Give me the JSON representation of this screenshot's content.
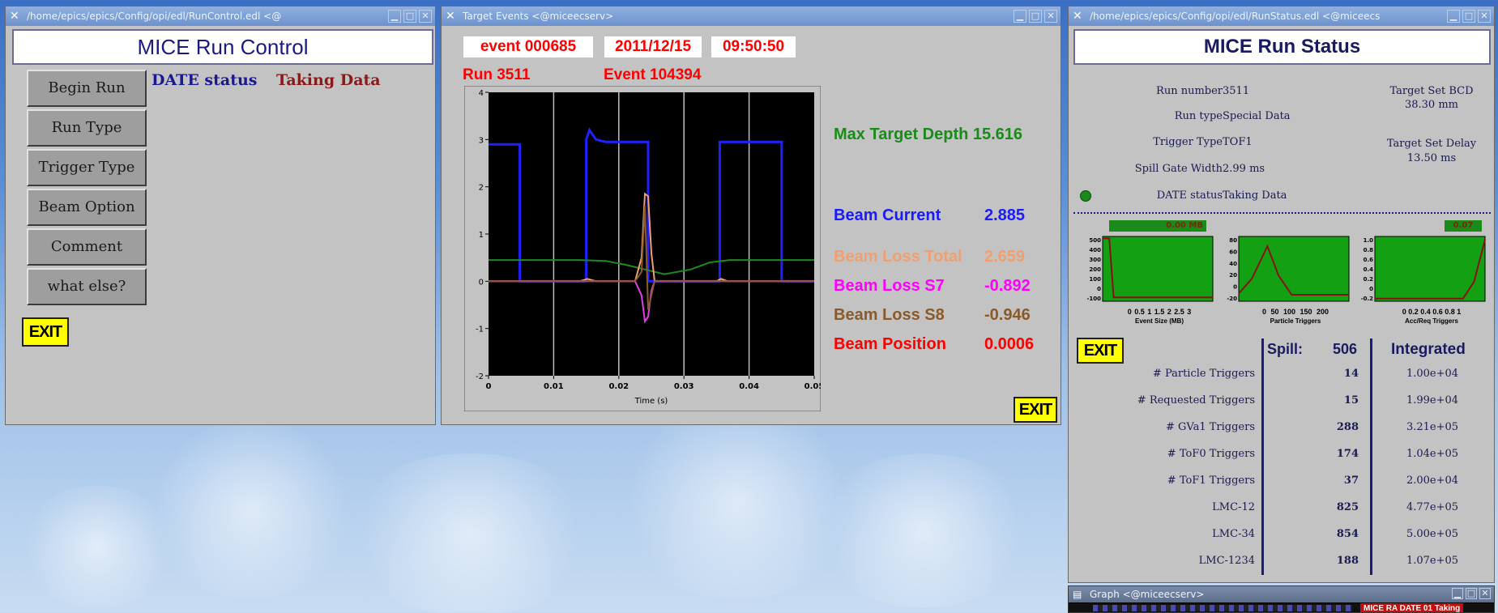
{
  "run_control": {
    "window_title": "/home/epics/epics/Config/opi/edl/RunControl.edl <@",
    "title": "MICE Run Control",
    "buttons": [
      "Begin Run",
      "Run Type",
      "Trigger Type",
      "Beam Option",
      "Comment",
      "what else?"
    ],
    "date_status_label": "DATE status",
    "date_status_value": "Taking Data",
    "exit_label": "EXIT"
  },
  "target_events": {
    "window_title": "Target Events <@miceecserv>",
    "event_label": "event 000685",
    "date": "2011/12/15",
    "time": "09:50:50",
    "run_label": "Run 3511",
    "event_count_label": "Event 104394",
    "max_depth_label": "Max Target Depth 15.616",
    "measurements": [
      {
        "label": "Beam Current",
        "value": "2.885",
        "color": "#1a1aff"
      },
      {
        "label": "Beam Loss Total",
        "value": "2.659",
        "color": "#f0a070"
      },
      {
        "label": "Beam Loss S7",
        "value": "-0.892",
        "color": "#ff00ff"
      },
      {
        "label": "Beam Loss S8",
        "value": "-0.946",
        "color": "#8a5a2a"
      },
      {
        "label": "Beam Position",
        "value": "0.0006",
        "color": "#ff0000"
      }
    ],
    "exit_label": "EXIT",
    "chart_data": {
      "type": "line",
      "xlabel": "Time (s)",
      "xlim": [
        0,
        0.05
      ],
      "ylim": [
        -2,
        4
      ],
      "x_ticks": [
        "0",
        "0.01",
        "0.02",
        "0.03",
        "0.04",
        "0.05"
      ],
      "y_ticks": [
        "-2",
        "-1",
        "0",
        "1",
        "2",
        "3",
        "4"
      ],
      "vlines": [
        0.01,
        0.02,
        0.03,
        0.04
      ],
      "series": [
        {
          "color": "#2020ff",
          "x": [
            0,
            0.0048,
            0.0048,
            0.015,
            0.015,
            0.0155,
            0.0165,
            0.018,
            0.0245,
            0.0245,
            0.0355,
            0.0355,
            0.0365,
            0.045,
            0.045,
            0.05
          ],
          "y": [
            2.9,
            2.9,
            0,
            0,
            3.0,
            3.2,
            3.0,
            2.95,
            2.95,
            0,
            0,
            2.95,
            2.95,
            2.95,
            0,
            0
          ]
        },
        {
          "color": "#1e8a1e",
          "x": [
            0,
            0.014,
            0.018,
            0.021,
            0.024,
            0.027,
            0.031,
            0.034,
            0.037,
            0.05
          ],
          "y": [
            0.45,
            0.45,
            0.43,
            0.35,
            0.25,
            0.15,
            0.25,
            0.4,
            0.45,
            0.45
          ]
        },
        {
          "color": "#f0a070",
          "x": [
            0,
            0.014,
            0.0152,
            0.0165,
            0.0225,
            0.0235,
            0.024,
            0.0245,
            0.025,
            0.0255,
            0.035,
            0.0357,
            0.0367,
            0.05
          ],
          "y": [
            0,
            0,
            0.05,
            0,
            0,
            0.5,
            1.85,
            1.8,
            0.6,
            0,
            0,
            0.05,
            0,
            0
          ]
        },
        {
          "color": "#e040e0",
          "x": [
            0,
            0.0225,
            0.0235,
            0.024,
            0.0245,
            0.025,
            0.0255,
            0.05
          ],
          "y": [
            0,
            0,
            -0.3,
            -0.85,
            -0.75,
            -0.2,
            0,
            0
          ]
        },
        {
          "color": "#8a5a2a",
          "x": [
            0,
            0.0225,
            0.0235,
            0.024,
            0.0245,
            0.025,
            0.0255,
            0.05
          ],
          "y": [
            0,
            0,
            0.2,
            1.6,
            -0.6,
            -0.3,
            0,
            0
          ]
        }
      ]
    }
  },
  "run_status": {
    "window_title": "/home/epics/epics/Config/opi/edl/RunStatus.edl <@miceecs",
    "title": "MICE Run Status",
    "fields": [
      {
        "label": "Run number",
        "value": "3511"
      },
      {
        "label": "Run type",
        "value": "Special Data"
      },
      {
        "label": "Trigger Type",
        "value": "TOF1"
      },
      {
        "label": "Spill Gate Width",
        "value": "2.99 ms"
      },
      {
        "label": "DATE status",
        "value": "Taking Data"
      }
    ],
    "target_bcd_label": "Target Set BCD",
    "target_bcd_value": "38.30 mm",
    "target_delay_label": "Target Set Delay",
    "target_delay_value": "13.50 ms",
    "mini_plots": [
      {
        "xlabel": "Event Size (MB)",
        "xticks": "0 0.5 1 1.5 2 2.5 3",
        "yticks": [
          "500",
          "400",
          "300",
          "200",
          "100",
          "0",
          "-100"
        ],
        "badge": "0.00 MB"
      },
      {
        "xlabel": "Particle Triggers",
        "xticks": "0 50 100 150 200",
        "yticks": [
          "80",
          "60",
          "40",
          "20",
          "0",
          "-20"
        ],
        "badge": ""
      },
      {
        "xlabel": "Acc/Req Triggers",
        "xticks": "0 0.2 0.4 0.6 0.8 1",
        "yticks": [
          "1.0",
          "0.8",
          "0.6",
          "0.4",
          "0.2",
          "0",
          "-0.2"
        ],
        "badge": "0.07"
      }
    ],
    "exit_label": "EXIT",
    "spill_label": "Spill:",
    "spill_value": "506",
    "integrated_label": "Integrated",
    "triggers": [
      {
        "label": "# Particle Triggers",
        "spill": "14",
        "integrated": "1.00e+04"
      },
      {
        "label": "# Requested Triggers",
        "spill": "15",
        "integrated": "1.99e+04"
      },
      {
        "label": "# GVa1 Triggers",
        "spill": "288",
        "integrated": "3.21e+05"
      },
      {
        "label": "# ToF0 Triggers",
        "spill": "174",
        "integrated": "1.04e+05"
      },
      {
        "label": "# ToF1 Triggers",
        "spill": "37",
        "integrated": "2.00e+04"
      },
      {
        "label": "LMC-12",
        "spill": "825",
        "integrated": "4.77e+05"
      },
      {
        "label": "LMC-34",
        "spill": "854",
        "integrated": "5.00e+05"
      },
      {
        "label": "LMC-1234",
        "spill": "188",
        "integrated": "1.07e+05"
      }
    ]
  },
  "graph_window": {
    "window_title": "Graph <@miceecserv>",
    "strip_text": "MICE RA DATE 01 Taking"
  }
}
